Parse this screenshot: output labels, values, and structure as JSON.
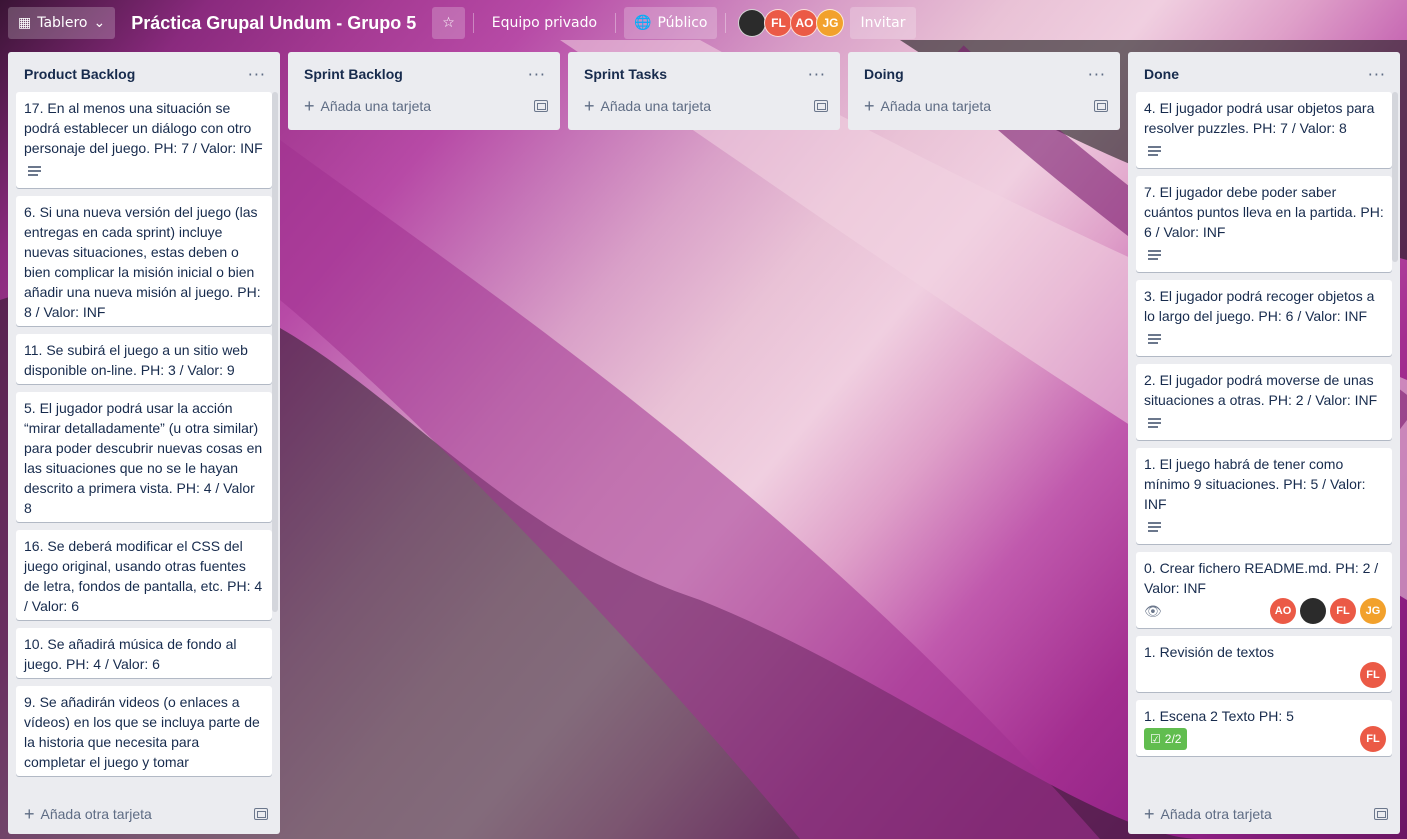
{
  "header": {
    "view_label": "Tablero",
    "board_title": "Práctica Grupal Undum - Grupo 5",
    "team_label": "Equipo privado",
    "visibility_label": "Público",
    "invite_label": "Invitar",
    "members": [
      {
        "initials": "",
        "color": "#2b2b2b"
      },
      {
        "initials": "FL",
        "color": "#eb5a46"
      },
      {
        "initials": "AO",
        "color": "#eb5a46"
      },
      {
        "initials": "JG",
        "color": "#f2a12c"
      }
    ]
  },
  "lists": [
    {
      "name": "Product Backlog",
      "add_label": "Añada otra tarjeta",
      "cards": [
        {
          "text": "17. En al menos una situación se podrá establecer un diálogo con otro personaje del juego. PH: 7 / Valor: INF",
          "desc": true
        },
        {
          "text": "6. Si una nueva versión del juego (las entregas en cada sprint) incluye nuevas situaciones, estas deben o bien complicar la misión inicial o bien añadir una nueva misión al juego. PH: 8 / Valor: INF",
          "desc": false
        },
        {
          "text": "11. Se subirá el juego a un sitio web disponible on-line. PH: 3 / Valor: 9",
          "desc": false
        },
        {
          "text": "5. El jugador podrá usar la acción “mirar detalladamente” (u otra similar) para poder descubrir nuevas cosas en las situaciones que no se le hayan descrito a primera vista. PH: 4 / Valor 8",
          "desc": false
        },
        {
          "text": "16. Se deberá modificar el CSS del juego original, usando otras fuentes de letra, fondos de pantalla, etc. PH: 4 / Valor: 6",
          "desc": false
        },
        {
          "text": "10. Se añadirá música de fondo al juego. PH: 4 / Valor: 6",
          "desc": false
        },
        {
          "text": "9. Se añadirán videos (o enlaces a vídeos) en los que se incluya parte de la historia que necesita para completar el juego y tomar",
          "desc": false
        }
      ]
    },
    {
      "name": "Sprint Backlog",
      "add_label": "Añada una tarjeta",
      "cards": []
    },
    {
      "name": "Sprint Tasks",
      "add_label": "Añada una tarjeta",
      "cards": []
    },
    {
      "name": "Doing",
      "add_label": "Añada una tarjeta",
      "cards": []
    },
    {
      "name": "Done",
      "add_label": "Añada otra tarjeta",
      "cards": [
        {
          "text": "4. El jugador podrá usar objetos para resolver puzzles. PH: 7 / Valor: 8",
          "desc": true
        },
        {
          "text": "7. El jugador debe poder saber cuántos puntos lleva en la partida. PH: 6 / Valor: INF",
          "desc": true
        },
        {
          "text": "3. El jugador podrá recoger objetos a lo largo del juego. PH: 6 / Valor: INF",
          "desc": true
        },
        {
          "text": "2. El jugador podrá moverse de unas situaciones a otras. PH: 2 / Valor: INF",
          "desc": true
        },
        {
          "text": "1. El juego habrá de tener como mínimo 9 situaciones. PH: 5 / Valor: INF",
          "desc": true
        },
        {
          "text": "0. Crear fichero README.md. PH: 2 / Valor: INF",
          "watch": true,
          "members": [
            "AO",
            "",
            "FL",
            "JG"
          ]
        },
        {
          "text": "1. Revisión de textos",
          "members": [
            "FL"
          ]
        },
        {
          "text": "1. Escena 2 Texto PH: 5",
          "checklist": "2/2",
          "members": [
            "FL"
          ]
        }
      ]
    }
  ]
}
